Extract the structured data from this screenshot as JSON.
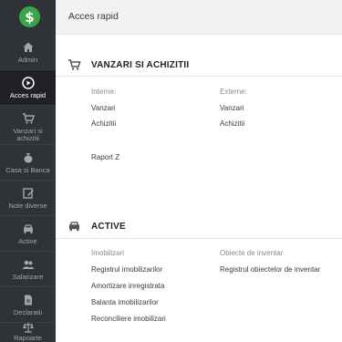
{
  "header": {
    "title": "Acces rapid"
  },
  "sidebar": {
    "logo_symbol": "$",
    "items": [
      {
        "label": "Admin",
        "icon": "home-icon"
      },
      {
        "label": "Acces rapid",
        "icon": "play-circle-icon",
        "active": true
      },
      {
        "label": "Vanzari si achizitii",
        "icon": "cart-icon"
      },
      {
        "label": "Casa si Banca",
        "icon": "money-bag-icon"
      },
      {
        "label": "Note diverse",
        "icon": "edit-note-icon"
      },
      {
        "label": "Active",
        "icon": "car-icon"
      },
      {
        "label": "Salarizare",
        "icon": "users-icon"
      },
      {
        "label": "Declaratii",
        "icon": "document-icon"
      },
      {
        "label": "Rapoarte",
        "icon": "scale-icon"
      }
    ]
  },
  "sections": {
    "vanzari": {
      "title": "VANZARI SI ACHIZITII",
      "icon": "cart-icon",
      "col1_label": "Interne:",
      "col2_label": "Externe:",
      "col1_links": [
        "Vanzari",
        "Achizitii"
      ],
      "col2_links": [
        "Vanzari",
        "Achizitii"
      ],
      "extra_link": "Raport Z"
    },
    "active": {
      "title": "ACTIVE",
      "icon": "car-icon",
      "col1_label": "Imobilizari",
      "col2_label": "Obiecte de inventar",
      "col1_links": [
        "Registrul imobilizarilor",
        "Amortizare inregistrata",
        "Balanta imobilizarilor",
        "Reconciliere imobilizari"
      ],
      "col2_links": [
        "Registrul obiectelor de inventar"
      ]
    }
  }
}
